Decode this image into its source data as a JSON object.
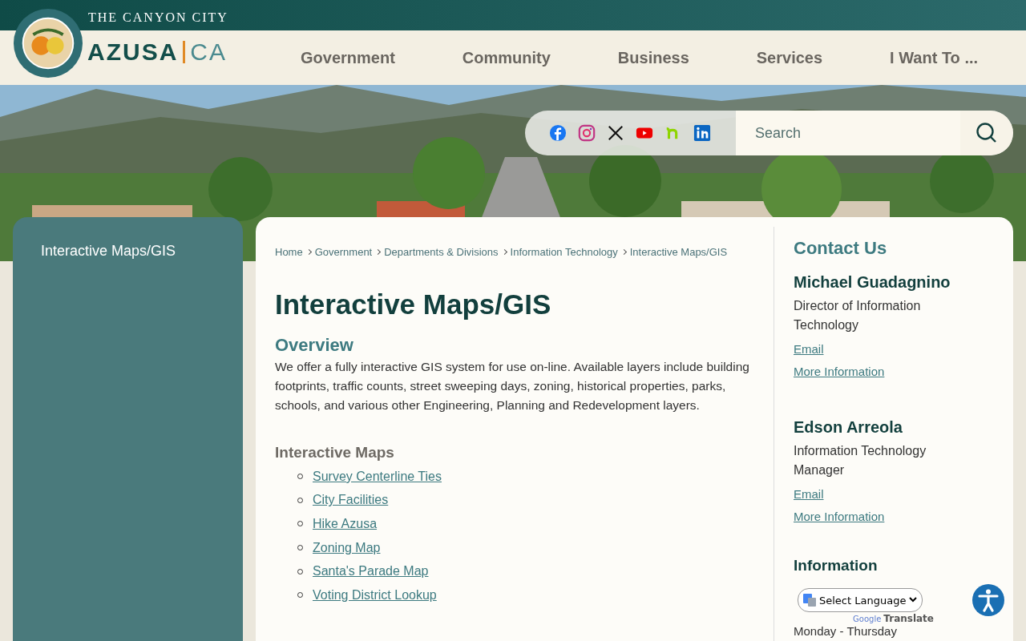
{
  "header": {
    "tagline": "THE CANYON CITY",
    "logo_left": "AZUSA",
    "logo_right": "CA"
  },
  "nav": [
    {
      "label": "Government"
    },
    {
      "label": "Community"
    },
    {
      "label": "Business"
    },
    {
      "label": "Services"
    },
    {
      "label": "I Want To ..."
    }
  ],
  "social": [
    {
      "kind": "facebook"
    },
    {
      "kind": "instagram"
    },
    {
      "kind": "x"
    },
    {
      "kind": "youtube"
    },
    {
      "kind": "nextdoor"
    },
    {
      "kind": "linkedin"
    }
  ],
  "search": {
    "placeholder": "Search"
  },
  "sidebar": {
    "items": [
      {
        "label": "Interactive Maps/GIS"
      }
    ]
  },
  "breadcrumbs": [
    "Home",
    "Government",
    "Departments & Divisions",
    "Information Technology",
    "Interactive Maps/GIS"
  ],
  "page_title": "Interactive Maps/GIS",
  "overview": {
    "heading": "Overview",
    "text": "We offer a fully interactive GIS system for use on-line. Available layers include building footprints, traffic counts, street sweeping days, zoning, historical properties, parks, schools, and various other Engineering, Planning and Redevelopment layers."
  },
  "maps": {
    "heading": "Interactive Maps",
    "links": [
      "Survey Centerline Ties",
      "City Facilities",
      "Hike Azusa",
      "Zoning Map",
      "Santa's Parade Map",
      "Voting District Lookup"
    ]
  },
  "contact": {
    "heading": "Contact Us",
    "people": [
      {
        "name": "Michael Guadagnino",
        "title": "Director of Information Technology",
        "links": [
          "Email",
          "More Information"
        ]
      },
      {
        "name": "Edson Arreola",
        "title": "Information Technology Manager",
        "links": [
          "Email",
          "More Information"
        ]
      }
    ],
    "info_heading": "Information",
    "hours": "Monday - Thursday"
  },
  "translate": {
    "select": "Select Language",
    "brand": "Google",
    "label": "Translate"
  }
}
